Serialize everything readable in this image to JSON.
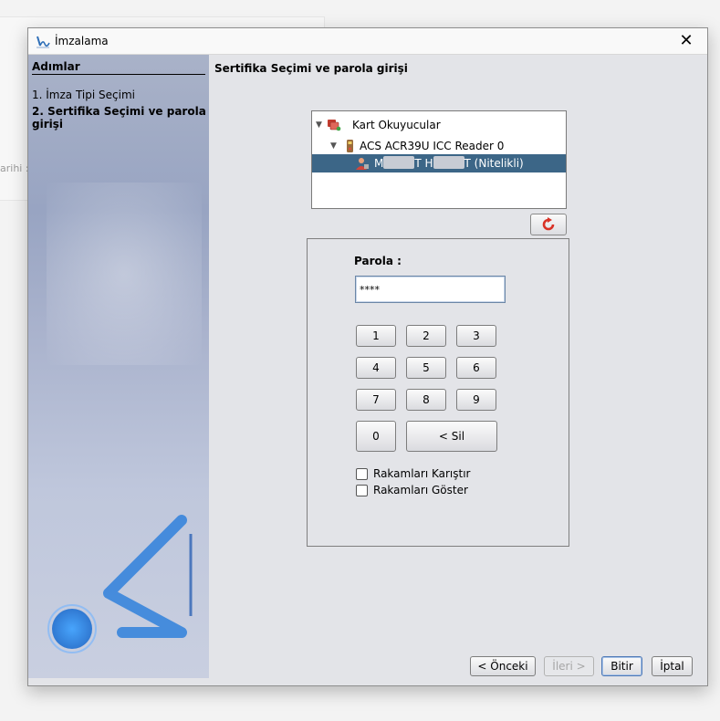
{
  "background": {
    "partial_label": "arihi :"
  },
  "window": {
    "title": "İmzalama",
    "close_glyph": "✕"
  },
  "steps_panel": {
    "heading": "Adımlar",
    "items": [
      {
        "label": "1. İmza Tipi Seçimi",
        "active": false
      },
      {
        "label": "2. Sertifika Seçimi ve parola girişi",
        "active": true
      }
    ]
  },
  "content": {
    "title": "Sertifika Seçimi ve parola girişi",
    "tree": {
      "root": {
        "label": "Kart Okuyucular",
        "expanded": true,
        "icon": "card-readers-icon"
      },
      "reader": {
        "label": "ACS ACR39U ICC Reader 0",
        "expanded": true,
        "icon": "card-reader-icon"
      },
      "certificate": {
        "label_part1": "M",
        "label_part2": "T H",
        "label_part3": "T (Nitelikli)",
        "selected": true,
        "icon": "user-certificate-icon"
      }
    },
    "refresh": {
      "icon": "refresh-icon"
    },
    "password": {
      "label": "Parola :",
      "value": "****",
      "keys": [
        "1",
        "2",
        "3",
        "4",
        "5",
        "6",
        "7",
        "8",
        "9",
        "0"
      ],
      "delete_label": "< Sil",
      "shuffle_label": "Rakamları Karıştır",
      "shuffle_checked": false,
      "show_label": "Rakamları Göster",
      "show_checked": false
    }
  },
  "footer": {
    "prev": "< Önceki",
    "next": "İleri >",
    "finish": "Bitir",
    "cancel": "İptal"
  },
  "colors": {
    "selection": "#3c6687",
    "dialog_bg": "#e3e4e8",
    "logo_blue": "#2f7fd8"
  }
}
